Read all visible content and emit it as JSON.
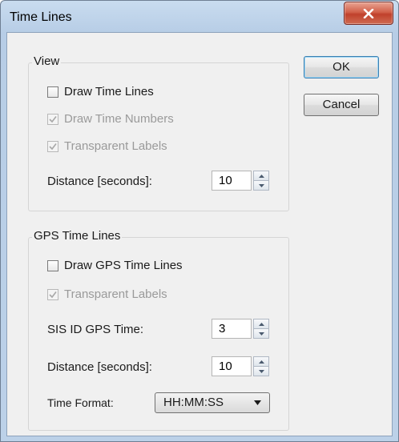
{
  "window": {
    "title": "Time Lines"
  },
  "buttons": {
    "ok": "OK",
    "cancel": "Cancel"
  },
  "view": {
    "label": "View",
    "draw_time_lines": {
      "label": "Draw Time Lines",
      "checked": false,
      "enabled": true
    },
    "draw_time_numbers": {
      "label": "Draw Time Numbers",
      "checked": true,
      "enabled": false
    },
    "transparent_labels": {
      "label": "Transparent Labels",
      "checked": true,
      "enabled": false
    },
    "distance_label": "Distance [seconds]:",
    "distance_value": "10"
  },
  "gps": {
    "label": "GPS Time Lines",
    "draw_gps_time_lines": {
      "label": "Draw GPS Time Lines",
      "checked": false,
      "enabled": true
    },
    "transparent_labels": {
      "label": "Transparent Labels",
      "checked": true,
      "enabled": false
    },
    "sis_id_label": "SIS ID GPS Time:",
    "sis_id_value": "3",
    "distance_label": "Distance [seconds]:",
    "distance_value": "10",
    "time_format_label": "Time Format:",
    "time_format_value": "HH:MM:SS"
  },
  "icons": {
    "close": "close-icon",
    "check": "check-icon",
    "spin_up": "spin-up-icon",
    "spin_down": "spin-down-icon",
    "dropdown": "chevron-down-icon"
  },
  "colors": {
    "frame": "#bcd1e8",
    "close_button": "#c0412c",
    "client": "#f0f0f0",
    "disabled_text": "#9a9a9a"
  }
}
